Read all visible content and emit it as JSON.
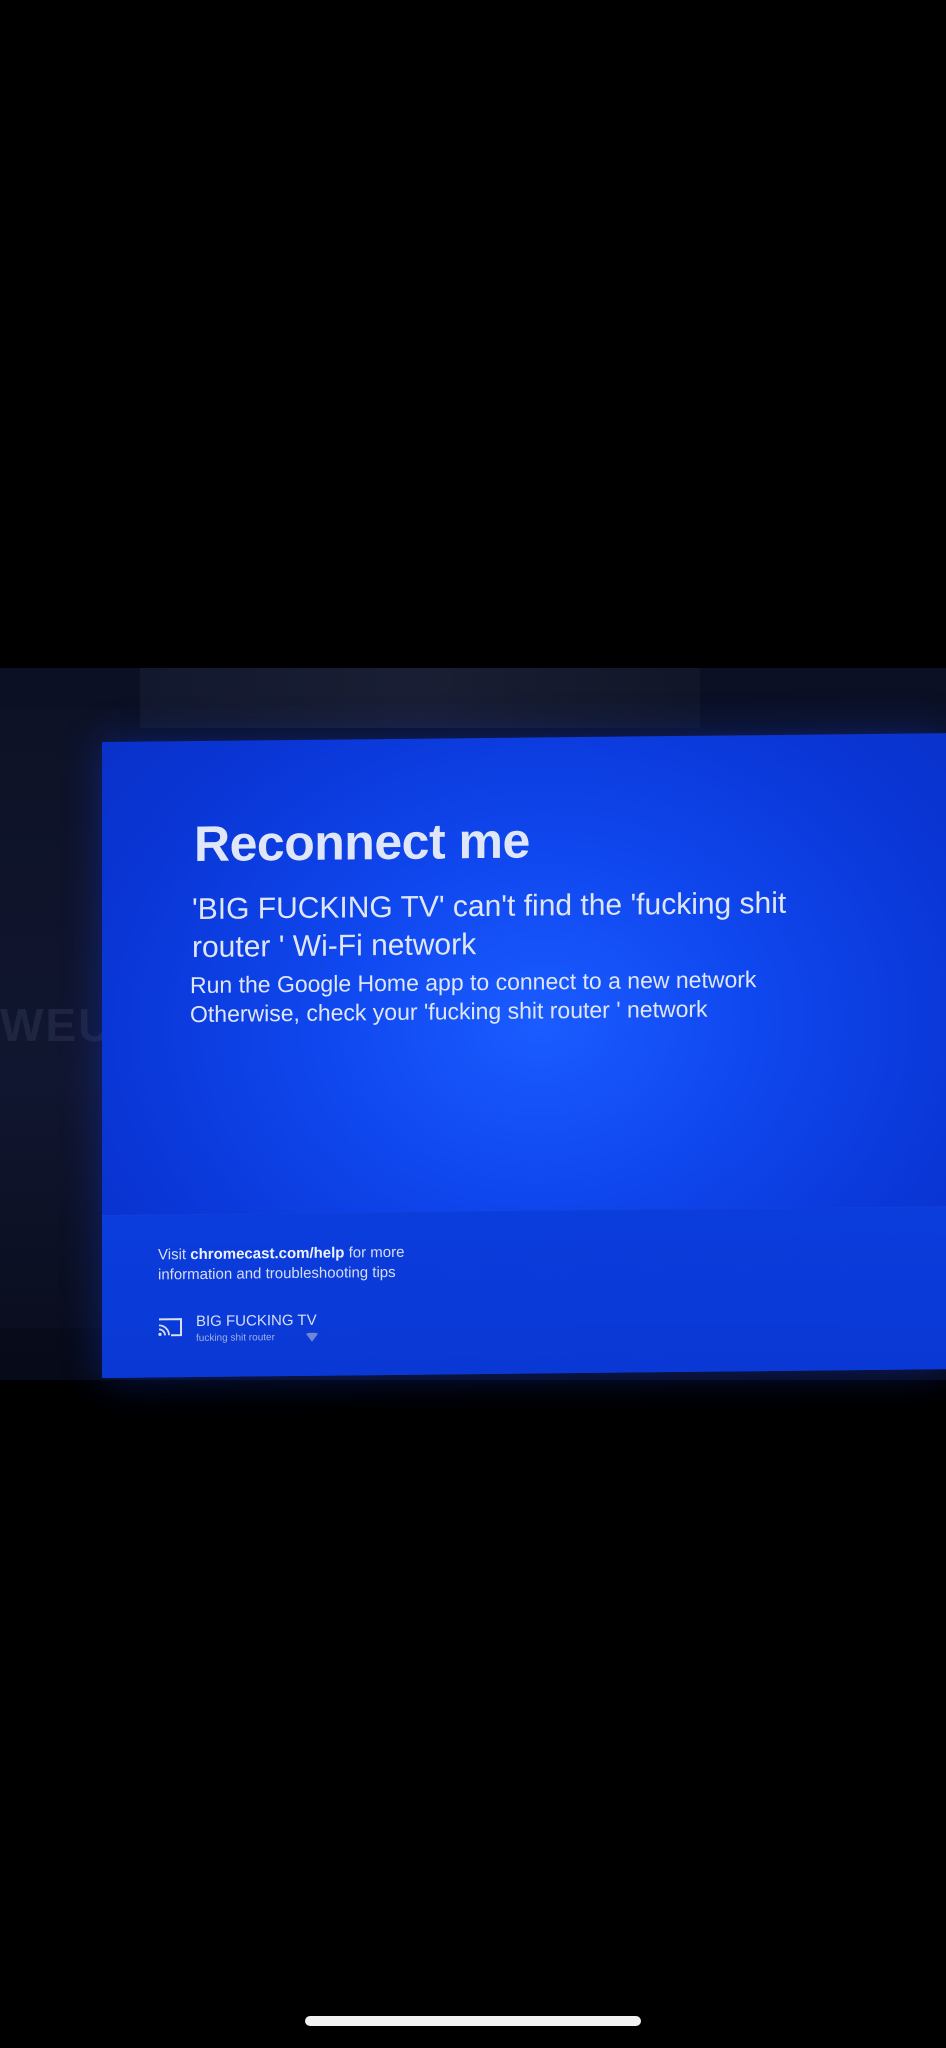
{
  "screen": {
    "title": "Reconnect me",
    "subtitle": "'BIG FUCKING TV' can't find the 'fucking shit router ' Wi-Fi network",
    "instruction_line1": "Run the Google Home app to connect to a new network",
    "instruction_line2": "Otherwise, check your 'fucking shit router ' network"
  },
  "footer": {
    "help_prefix": "Visit ",
    "help_link": "chromecast.com/help",
    "help_suffix": " for more information and troubleshooting tips",
    "device_name": "BIG FUCKING TV",
    "network_name": "fucking shit router",
    "cast_icon": "cast-icon",
    "wifi_icon": "wifi-icon"
  },
  "background": {
    "room_text": "WEUL"
  },
  "colors": {
    "screen_blue": "#0f47ee",
    "footer_blue": "#0a38d4",
    "text": "#dfe6f7"
  }
}
